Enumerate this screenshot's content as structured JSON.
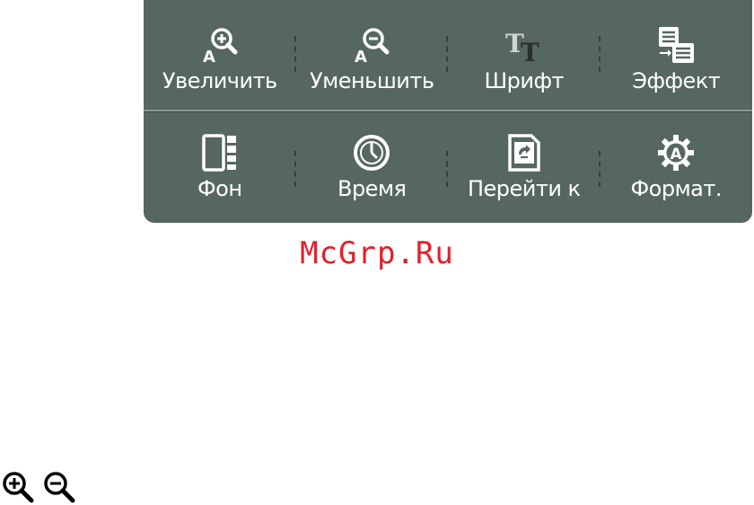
{
  "toolbar": {
    "row1": [
      {
        "label": "Увеличить",
        "icon": "zoom-in-icon"
      },
      {
        "label": "Уменьшить",
        "icon": "zoom-out-icon"
      },
      {
        "label": "Шрифт",
        "icon": "font-icon"
      },
      {
        "label": "Эффект",
        "icon": "effect-icon"
      }
    ],
    "row2": [
      {
        "label": "Фон",
        "icon": "background-icon"
      },
      {
        "label": "Время",
        "icon": "clock-icon"
      },
      {
        "label": "Перейти к",
        "icon": "goto-icon"
      },
      {
        "label": "Формат.",
        "icon": "format-gear-icon"
      }
    ]
  },
  "watermark": "McGrp.Ru",
  "legend_icons": [
    "zoom-in-icon",
    "zoom-out-icon"
  ],
  "colors": {
    "panel": "#566663",
    "watermark": "#e3202a",
    "label": "#ffffff"
  }
}
